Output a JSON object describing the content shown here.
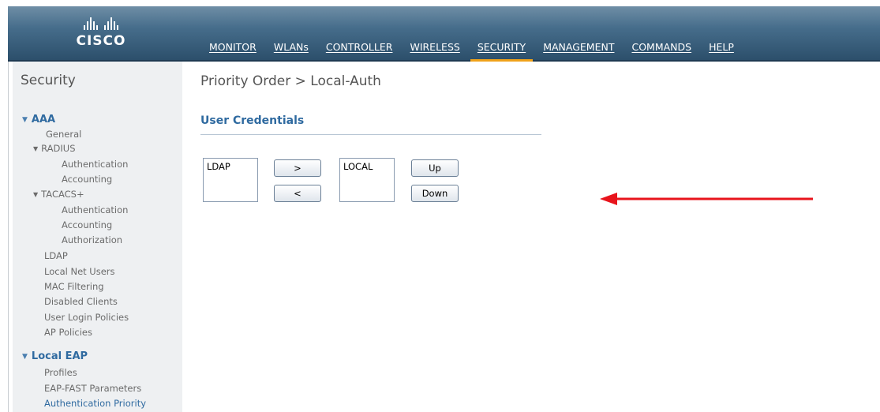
{
  "brand": {
    "name": "CISCO"
  },
  "nav": {
    "items": [
      {
        "label": "MONITOR"
      },
      {
        "label": "WLANs"
      },
      {
        "label": "CONTROLLER"
      },
      {
        "label": "WIRELESS"
      },
      {
        "label": "SECURITY",
        "active": true
      },
      {
        "label": "MANAGEMENT"
      },
      {
        "label": "COMMANDS"
      },
      {
        "label": "HELP"
      }
    ]
  },
  "sidebar": {
    "title": "Security",
    "aaa": {
      "label": "AAA",
      "general": "General",
      "radius": "RADIUS",
      "radius_authentication": "Authentication",
      "radius_accounting": "Accounting",
      "tacacs": "TACACS+",
      "tacacs_authentication": "Authentication",
      "tacacs_accounting": "Accounting",
      "tacacs_authorization": "Authorization",
      "ldap": "LDAP",
      "local_net_users": "Local Net Users",
      "mac_filtering": "MAC Filtering",
      "disabled_clients": "Disabled Clients",
      "user_login_policies": "User Login Policies",
      "ap_policies": "AP Policies"
    },
    "local_eap": {
      "label": "Local EAP",
      "profiles": "Profiles",
      "eap_fast_parameters": "EAP-FAST Parameters",
      "authentication_priority": "Authentication Priority"
    }
  },
  "main": {
    "title": "Priority Order > Local-Auth",
    "section_heading": "User Credentials",
    "available_list": [
      "LDAP"
    ],
    "selected_list": [
      "LOCAL"
    ],
    "buttons": {
      "move_right": ">",
      "move_left": "<",
      "up": "Up",
      "down": "Down"
    }
  },
  "colors": {
    "header_top": "#6f8ea6",
    "header_bottom": "#2c4f6b",
    "active_underline": "#f0a21a",
    "link_blue": "#2f6aa0",
    "annotation_arrow": "#e8141c"
  }
}
